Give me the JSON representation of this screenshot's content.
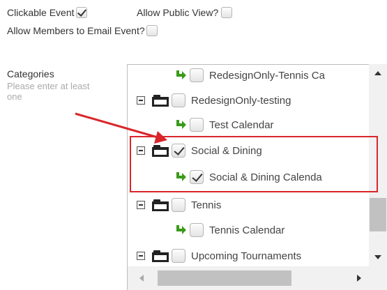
{
  "options": {
    "clickable_event": {
      "label": "Clickable Event",
      "checked": true
    },
    "allow_public_view": {
      "label": "Allow Public View?",
      "checked": false
    },
    "allow_members_email": {
      "label": "Allow Members to Email Event?",
      "checked": false
    }
  },
  "categories": {
    "label": "Categories",
    "help": "Please enter at least one",
    "items": [
      {
        "label": "RedesignOnly-Tennis Ca",
        "type": "calendar",
        "checked": false
      },
      {
        "label": "RedesignOnly-testing",
        "type": "folder",
        "checked": false
      },
      {
        "label": "Test Calendar",
        "type": "calendar",
        "checked": false
      },
      {
        "label": "Social & Dining",
        "type": "folder",
        "checked": true
      },
      {
        "label": "Social & Dining Calenda",
        "type": "calendar",
        "checked": true
      },
      {
        "label": "Tennis",
        "type": "folder",
        "checked": false
      },
      {
        "label": "Tennis Calendar",
        "type": "calendar",
        "checked": false
      },
      {
        "label": "Upcoming Tournaments",
        "type": "folder",
        "checked": false
      }
    ]
  },
  "icons": {
    "collapse": "minus-box-icon",
    "folder": "folder-icon",
    "child": "green-arrow-icon"
  },
  "colors": {
    "annotation": "#d9262a",
    "child_arrow": "#3a9a1a"
  }
}
